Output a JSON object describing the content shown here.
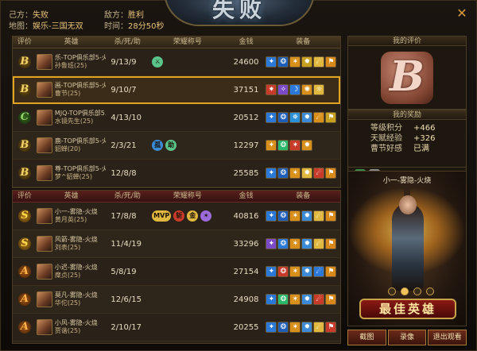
{
  "header": {
    "our_side_label": "己方：",
    "our_side_value": "失败",
    "enemy_label": "敌方：",
    "enemy_value": "胜利",
    "map_label": "地图：",
    "map_value": "娱乐-三国无双",
    "time_label": "时间：",
    "time_value": "28分50秒",
    "banner_text": "失败",
    "close_icon": "close-icon"
  },
  "columns": [
    "评价",
    "英雄",
    "杀/死/助",
    "荣耀称号",
    "金钱",
    "装备"
  ],
  "our_team": [
    {
      "grade": "B",
      "player": "乐-TOP俱乐部5-火...",
      "hero": "孙鲁班(25)",
      "kda": "9/13/9",
      "honors": [
        {
          "t": "⚔",
          "c": "#5bc48a"
        }
      ],
      "gold": "24600",
      "equip": [
        [
          "#2a78d8",
          "✦"
        ],
        [
          "#1d5fb8",
          "❂"
        ],
        [
          "#d8901a",
          "✶"
        ],
        [
          "#c8a020",
          "✹"
        ],
        [
          "#e0b840",
          "☄"
        ],
        [
          "#d88818",
          "⚑"
        ]
      ],
      "highlight": false
    },
    {
      "grade": "B",
      "player": "画-TOP俱乐部5-火...",
      "hero": "曹节(25)",
      "kda": "9/10/7",
      "honors": [],
      "gold": "37151",
      "equip": [
        [
          "#c83a2a",
          "✷"
        ],
        [
          "#7a4ac8",
          "✧"
        ],
        [
          "#2a78d8",
          "☽"
        ],
        [
          "#d8901a",
          "✺"
        ],
        [
          "#e0b840",
          "☼"
        ]
      ],
      "highlight": true
    },
    {
      "grade": "C",
      "player": "MJQ-TOP俱乐部5...",
      "hero": "水镜先生(25)",
      "kda": "4/13/10",
      "honors": [],
      "gold": "20512",
      "equip": [
        [
          "#2a78d8",
          "✦"
        ],
        [
          "#1d5fb8",
          "❂"
        ],
        [
          "#2a90d8",
          "✵"
        ],
        [
          "#3a8ad8",
          "✹"
        ],
        [
          "#d8901a",
          "☄"
        ],
        [
          "#c8a020",
          "⚑"
        ]
      ],
      "highlight": false
    },
    {
      "grade": "B",
      "player": "鹿-TOP俱乐部5-火...",
      "hero": "貂蝉(20)",
      "kda": "2/3/21",
      "honors": [
        {
          "t": "孤",
          "c": "#3a8ad8"
        },
        {
          "t": "助",
          "c": "#5bc48a"
        }
      ],
      "gold": "12297",
      "equip": [
        [
          "#d8901a",
          "✦"
        ],
        [
          "#2ab86a",
          "❂"
        ],
        [
          "#c83a2a",
          "✶"
        ],
        [
          "#d8901a",
          "✹"
        ]
      ],
      "highlight": false
    },
    {
      "grade": "B",
      "player": "尊-TOP俱乐部5-火...",
      "hero": "梦^貂蝉(25)",
      "kda": "12/8/8",
      "honors": [],
      "gold": "25585",
      "equip": [
        [
          "#2a78d8",
          "✦"
        ],
        [
          "#1d5fb8",
          "❂"
        ],
        [
          "#d8901a",
          "✶"
        ],
        [
          "#e0b840",
          "✹"
        ],
        [
          "#c83a2a",
          "☄"
        ],
        [
          "#d88818",
          "⚑"
        ]
      ],
      "highlight": false
    }
  ],
  "enemy_team": [
    {
      "grade": "S",
      "player": "小一-雾隐-火烧",
      "hero": "黄月英(25)",
      "kda": "17/8/8",
      "honors": [
        {
          "t": "MVP",
          "c": "#e0b840"
        },
        {
          "t": "斩",
          "c": "#c83a2a"
        },
        {
          "t": "金",
          "c": "#e0b840"
        },
        {
          "t": "✶",
          "c": "#9a6ad8"
        }
      ],
      "gold": "40816",
      "equip": [
        [
          "#2a78d8",
          "✦"
        ],
        [
          "#1d5fb8",
          "❂"
        ],
        [
          "#d8901a",
          "✶"
        ],
        [
          "#3a8ad8",
          "✹"
        ],
        [
          "#e0b840",
          "☄"
        ],
        [
          "#d88818",
          "⚑"
        ]
      ],
      "highlight": false
    },
    {
      "grade": "S",
      "player": "风箭-雾隐-火烧",
      "hero": "刘表(25)",
      "kda": "11/4/19",
      "honors": [],
      "gold": "33296",
      "equip": [
        [
          "#7a4ac8",
          "✦"
        ],
        [
          "#2a78d8",
          "❂"
        ],
        [
          "#d8901a",
          "✶"
        ],
        [
          "#3a8ad8",
          "✹"
        ],
        [
          "#e0b840",
          "☄"
        ],
        [
          "#d88818",
          "⚑"
        ]
      ],
      "highlight": false
    },
    {
      "grade": "A",
      "player": "小迟-雾隐-火烧",
      "hero": "糜贞(25)",
      "kda": "5/8/19",
      "honors": [],
      "gold": "27154",
      "equip": [
        [
          "#2a78d8",
          "✦"
        ],
        [
          "#c83a2a",
          "❂"
        ],
        [
          "#d8901a",
          "✶"
        ],
        [
          "#3a8ad8",
          "✹"
        ],
        [
          "#2a78d8",
          "☄"
        ],
        [
          "#d88818",
          "⚑"
        ]
      ],
      "highlight": false
    },
    {
      "grade": "A",
      "player": "莫凡-雾隐-火烧",
      "hero": "华佗(25)",
      "kda": "12/6/15",
      "honors": [],
      "gold": "24908",
      "equip": [
        [
          "#2a78d8",
          "✦"
        ],
        [
          "#2ab86a",
          "❂"
        ],
        [
          "#d8901a",
          "✶"
        ],
        [
          "#3a8ad8",
          "✹"
        ],
        [
          "#c83a2a",
          "☄"
        ],
        [
          "#d88818",
          "⚑"
        ]
      ],
      "highlight": false
    },
    {
      "grade": "A",
      "player": "小风-雾隐-火烧",
      "hero": "贾谐(25)",
      "kda": "2/10/17",
      "honors": [],
      "gold": "20255",
      "equip": [
        [
          "#2a78d8",
          "✦"
        ],
        [
          "#1d5fb8",
          "❂"
        ],
        [
          "#d8901a",
          "✶"
        ],
        [
          "#3a8ad8",
          "✹"
        ],
        [
          "#e0b840",
          "☄"
        ],
        [
          "#c83a2a",
          "⚑"
        ]
      ],
      "highlight": false
    }
  ],
  "side": {
    "my_eval_title": "我的评价",
    "my_eval_grade": "B",
    "my_reward_title": "我的奖励",
    "rewards": [
      {
        "k": "等级积分",
        "v": "+466"
      },
      {
        "k": "天赋经验",
        "v": "+326"
      },
      {
        "k": "曹节好感",
        "v": "已满"
      }
    ],
    "reward_badges": [
      {
        "t": "❦",
        "c": "#3a8a4a"
      },
      {
        "t": "✦",
        "c": "#8a8a8a"
      }
    ],
    "best_hero_name": "小一-雾隐-火烧",
    "best_banner": "最佳英雄"
  },
  "buttons": {
    "screenshot": "截图",
    "record": "录像",
    "quit": "退出观看"
  }
}
